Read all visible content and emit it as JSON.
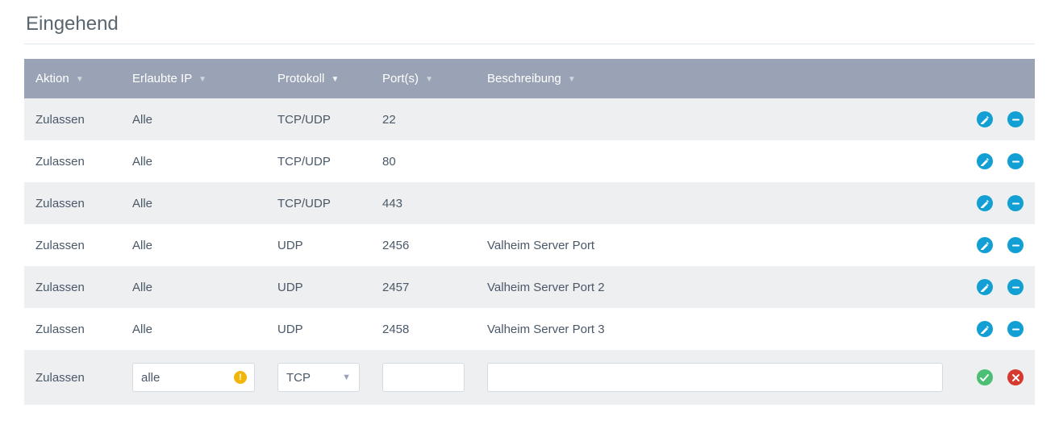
{
  "section": {
    "title": "Eingehend"
  },
  "table": {
    "headers": {
      "aktion": "Aktion",
      "ip": "Erlaubte IP",
      "protokoll": "Protokoll",
      "ports": "Port(s)",
      "beschreibung": "Beschreibung"
    },
    "rows": [
      {
        "aktion": "Zulassen",
        "ip": "Alle",
        "protokoll": "TCP/UDP",
        "ports": "22",
        "beschreibung": ""
      },
      {
        "aktion": "Zulassen",
        "ip": "Alle",
        "protokoll": "TCP/UDP",
        "ports": "80",
        "beschreibung": ""
      },
      {
        "aktion": "Zulassen",
        "ip": "Alle",
        "protokoll": "TCP/UDP",
        "ports": "443",
        "beschreibung": ""
      },
      {
        "aktion": "Zulassen",
        "ip": "Alle",
        "protokoll": "UDP",
        "ports": "2456",
        "beschreibung": "Valheim Server Port"
      },
      {
        "aktion": "Zulassen",
        "ip": "Alle",
        "protokoll": "UDP",
        "ports": "2457",
        "beschreibung": "Valheim Server Port 2"
      },
      {
        "aktion": "Zulassen",
        "ip": "Alle",
        "protokoll": "UDP",
        "ports": "2458",
        "beschreibung": "Valheim Server Port 3"
      }
    ],
    "new_row": {
      "aktion": "Zulassen",
      "ip_value": "alle",
      "protokoll_selected": "TCP",
      "ports_value": "",
      "beschreibung_value": ""
    }
  },
  "icons": {
    "edit": "edit-icon",
    "remove": "remove-icon",
    "confirm": "confirm-icon",
    "cancel": "cancel-icon",
    "warning": "warning-icon",
    "caret_down": "caret-down-icon"
  },
  "colors": {
    "header_bg": "#9aa3b5",
    "action_blue": "#129fd4",
    "confirm_green": "#4bbf73",
    "cancel_red": "#d63a2f",
    "warning_yellow": "#f2b50c"
  }
}
